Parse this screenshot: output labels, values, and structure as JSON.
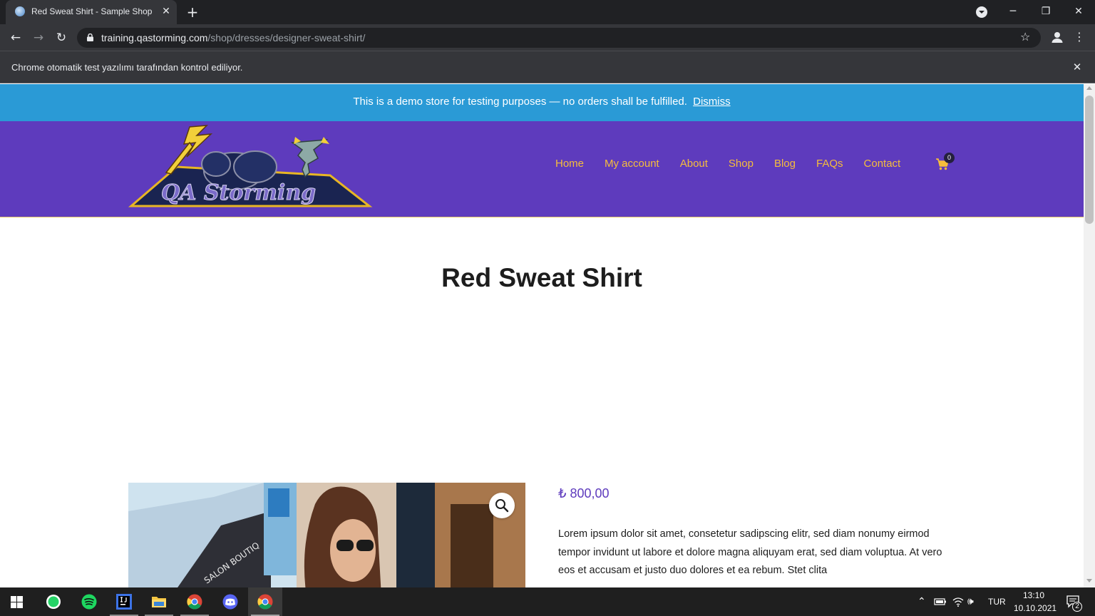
{
  "browser": {
    "tab_title": "Red Sweat Shirt - Sample Shop",
    "url_host": "training.qastorming.com",
    "url_path": "/shop/dresses/designer-sweat-shirt/",
    "infobar_text": "Chrome otomatik test yazılımı tarafından kontrol ediliyor."
  },
  "site": {
    "notice_text": "This is a demo store for testing purposes — no orders shall be fulfilled.",
    "notice_dismiss": "Dismiss",
    "logo_text": "QA Storming",
    "nav": [
      {
        "label": "Home"
      },
      {
        "label": "My account"
      },
      {
        "label": "About"
      },
      {
        "label": "Shop"
      },
      {
        "label": "Blog"
      },
      {
        "label": "FAQs"
      },
      {
        "label": "Contact"
      }
    ],
    "cart_count": "0"
  },
  "product": {
    "title": "Red Sweat Shirt",
    "price": "₺ 800,00",
    "description": "Lorem ipsum dolor sit amet, consetetur sadipscing elitr, sed diam nonumy eirmod tempor invidunt ut labore et dolore magna aliquyam erat, sed diam voluptua. At vero eos et accusam et justo duo dolores et ea rebum. Stet clita",
    "image_sign_text": "SALON BOUTIQ"
  },
  "taskbar": {
    "language": "TUR",
    "time": "13:10",
    "date": "10.10.2021",
    "notification_count": "2"
  },
  "colors": {
    "header_purple": "#5e3bbd",
    "nav_gold": "#f6bd3c",
    "notice_blue": "#2a9ad6"
  }
}
